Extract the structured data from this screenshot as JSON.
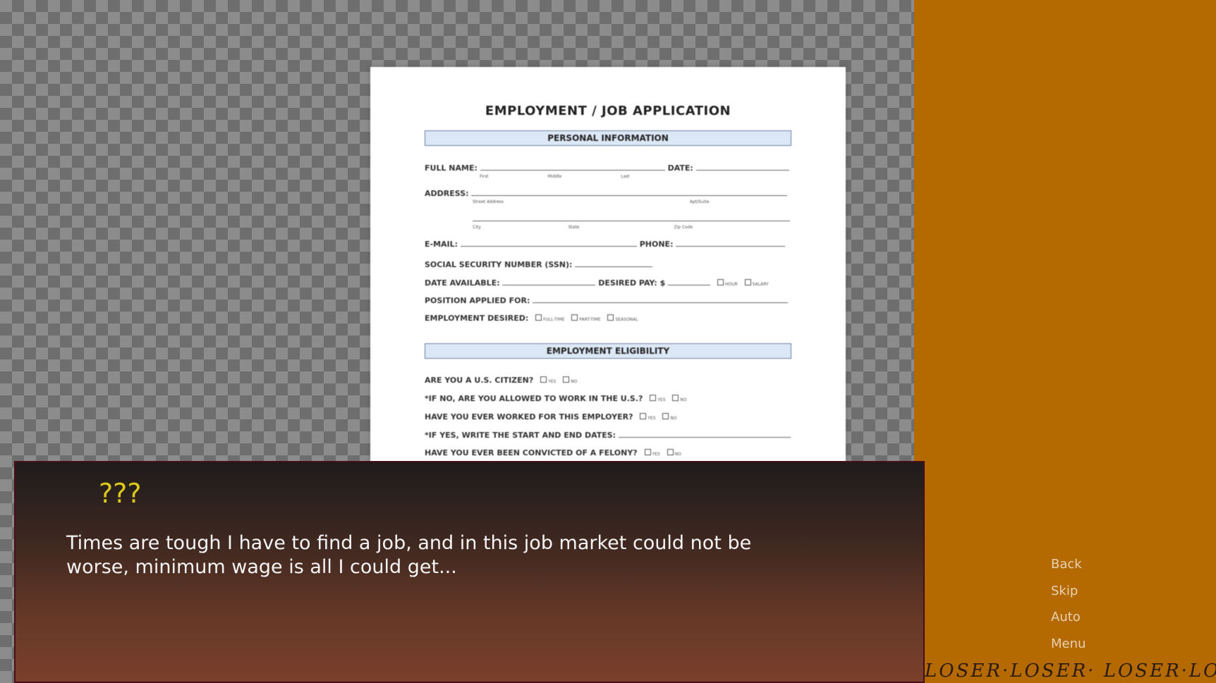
{
  "scene": {
    "document": {
      "title": "EMPLOYMENT / JOB APPLICATION",
      "sections": [
        {
          "header": "PERSONAL INFORMATION"
        },
        {
          "header": "EMPLOYMENT ELIGIBILITY"
        }
      ],
      "fields": {
        "full_name": "FULL NAME:",
        "first": "First",
        "middle": "Middle",
        "last": "Last",
        "date": "DATE:",
        "address": "ADDRESS:",
        "street": "Street Address",
        "apt": "Apt/Suite",
        "city": "City",
        "state": "State",
        "zip": "Zip Code",
        "email": "E-MAIL:",
        "phone": "PHONE:",
        "ssn": "SOCIAL SECURITY NUMBER (SSN):",
        "date_available": "DATE AVAILABLE:",
        "desired_pay": "DESIRED PAY: $",
        "hour": "HOUR",
        "salary": "SALARY",
        "position": "POSITION APPLIED FOR:",
        "employment_desired": "EMPLOYMENT DESIRED:",
        "full_time": "FULL-TIME",
        "part_time": "PART-TIME",
        "seasonal": "SEASONAL",
        "citizen": "ARE YOU A U.S. CITIZEN?",
        "allowed": "*IF NO, ARE YOU ALLOWED TO WORK IN THE U.S.?",
        "worked_before": "HAVE YOU EVER WORKED FOR THIS EMPLOYER?",
        "start_end": "*IF YES, WRITE THE START AND END DATES:",
        "felony": "HAVE YOU EVER BEEN CONVICTED OF A FELONY?",
        "yes": "YES",
        "no": "NO"
      }
    }
  },
  "dialog": {
    "speaker": "???",
    "text": "Times are tough I have to find a job, and in this job market could not be worse, minimum wage is all I could get..."
  },
  "quick_menu": {
    "back": "Back",
    "skip": "Skip",
    "auto": "Auto",
    "menu": "Menu"
  },
  "decor": {
    "loser_strip": "LOSER·LOSER· LOSER·LOSER"
  }
}
